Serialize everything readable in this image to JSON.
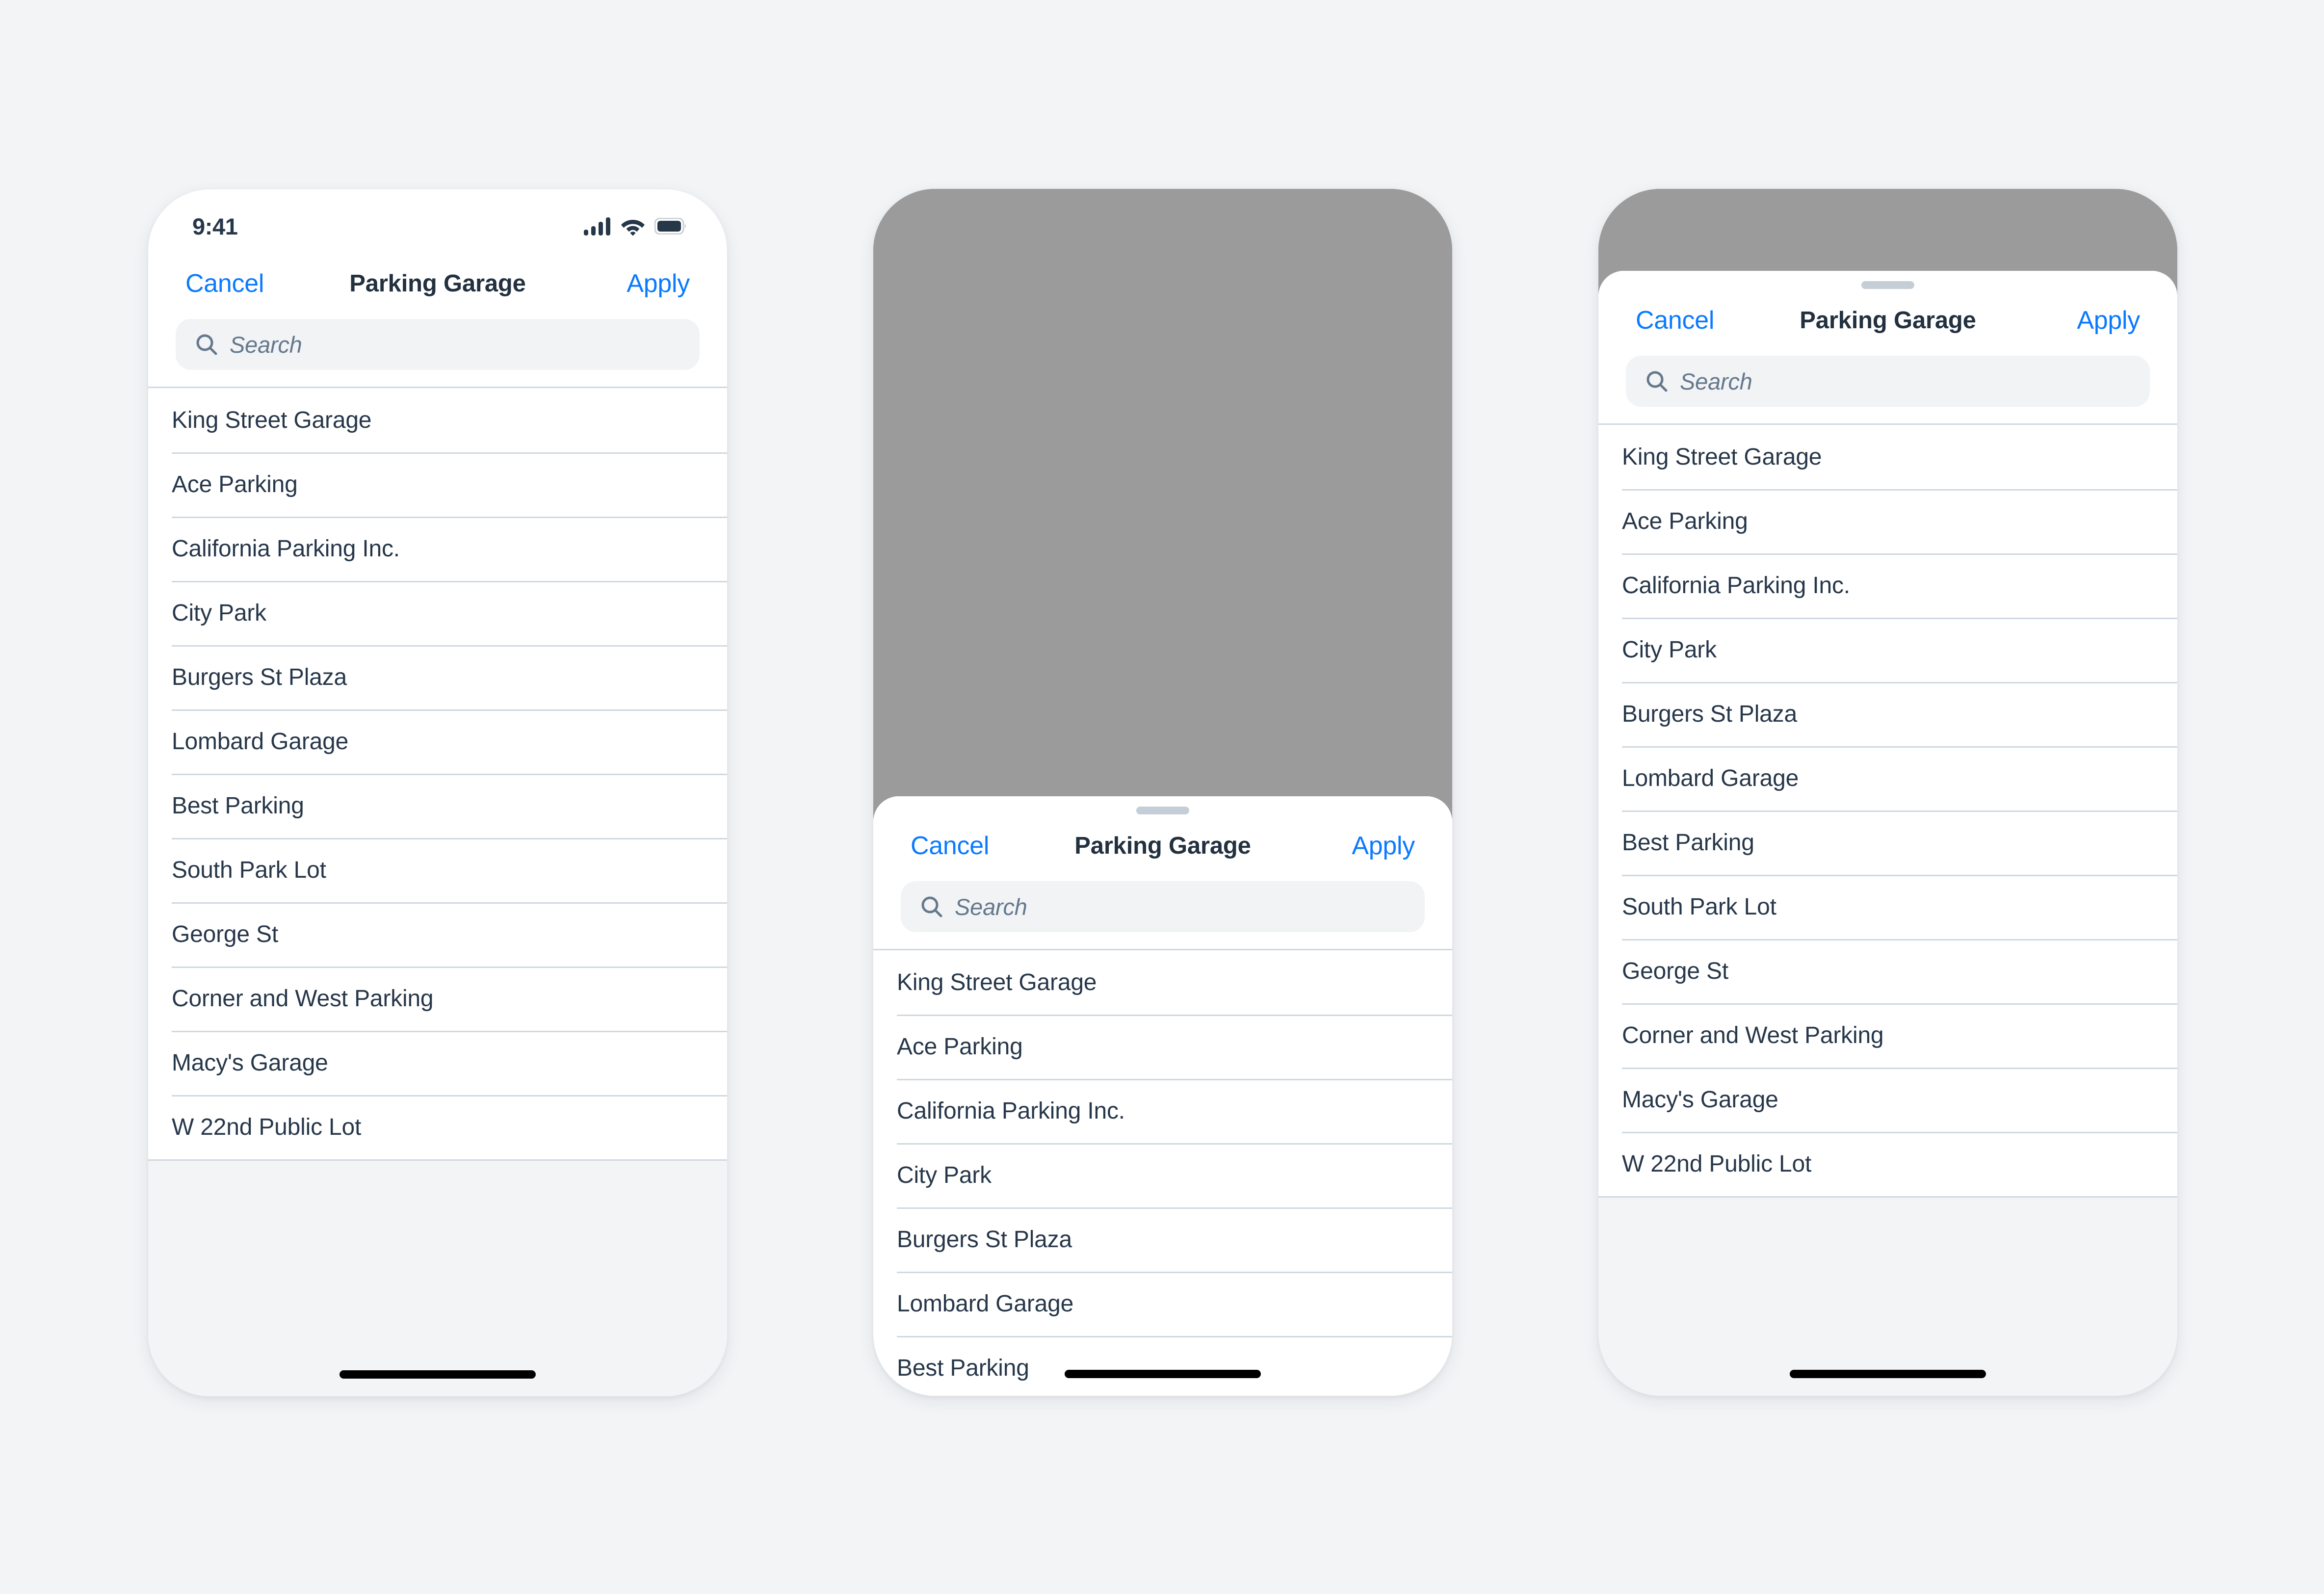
{
  "colors": {
    "page_background": "#f2f4f6",
    "accent_blue": "#0a7aff",
    "text_primary": "#27374a",
    "title": "#22303f",
    "separator": "#cfd8e0",
    "search_field_background": "#f1f3f5",
    "search_placeholder": "#65788c",
    "backdrop_dim": "#9b9b9c",
    "grabber": "#c5cdd6",
    "home_indicator": "#000000"
  },
  "status_bar": {
    "time": "9:41",
    "icons": [
      "cellular-signal-icon",
      "wifi-icon",
      "battery-icon"
    ],
    "battery_level": "full",
    "signal_bars": 4
  },
  "nav": {
    "cancel_label": "Cancel",
    "title": "Parking Garage",
    "apply_label": "Apply"
  },
  "search": {
    "placeholder": "Search",
    "value": "",
    "icon": "search-icon"
  },
  "list": {
    "items": [
      "King Street Garage",
      "Ace Parking",
      "California Parking Inc.",
      "City Park",
      "Burgers St Plaza",
      "Lombard Garage",
      "Best Parking",
      "South Park Lot",
      "George St",
      "Corner and West Parking",
      "Macy's Garage",
      "W 22nd Public Lot"
    ]
  },
  "screens": [
    {
      "id": "phone-1",
      "variant": "fullscreen-modal",
      "has_status_bar": true,
      "has_grabber": false,
      "has_backdrop": false,
      "visible_item_count": 12
    },
    {
      "id": "phone-2",
      "variant": "bottom-sheet-partial",
      "has_status_bar": false,
      "has_grabber": true,
      "has_backdrop": true,
      "visible_item_count": 7
    },
    {
      "id": "phone-3",
      "variant": "bottom-sheet-large",
      "has_status_bar": false,
      "has_grabber": true,
      "has_backdrop": true,
      "visible_item_count": 12
    }
  ]
}
